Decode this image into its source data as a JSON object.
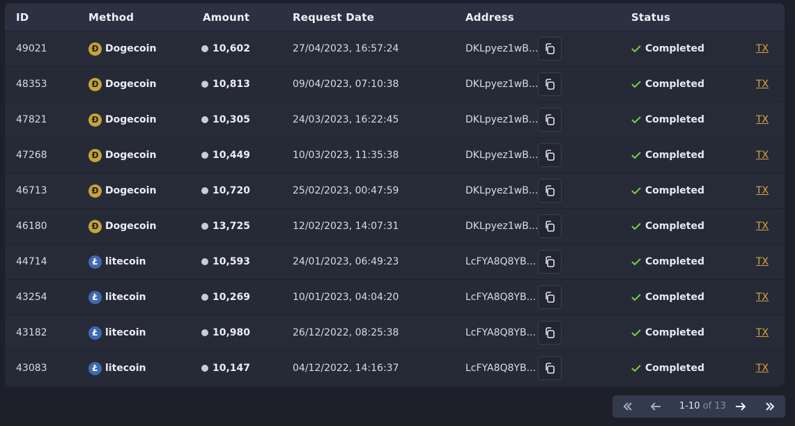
{
  "headers": {
    "id": "ID",
    "method": "Method",
    "amount": "Amount",
    "date": "Request Date",
    "address": "Address",
    "status": "Status"
  },
  "rows": [
    {
      "id": "49021",
      "method": "Dogecoin",
      "coin": "doge",
      "amount": "10,602",
      "date": "27/04/2023, 16:57:24",
      "address": "DKLpyez1wB...",
      "status": "Completed",
      "tx": "TX"
    },
    {
      "id": "48353",
      "method": "Dogecoin",
      "coin": "doge",
      "amount": "10,813",
      "date": "09/04/2023, 07:10:38",
      "address": "DKLpyez1wB...",
      "status": "Completed",
      "tx": "TX"
    },
    {
      "id": "47821",
      "method": "Dogecoin",
      "coin": "doge",
      "amount": "10,305",
      "date": "24/03/2023, 16:22:45",
      "address": "DKLpyez1wB...",
      "status": "Completed",
      "tx": "TX"
    },
    {
      "id": "47268",
      "method": "Dogecoin",
      "coin": "doge",
      "amount": "10,449",
      "date": "10/03/2023, 11:35:38",
      "address": "DKLpyez1wB...",
      "status": "Completed",
      "tx": "TX"
    },
    {
      "id": "46713",
      "method": "Dogecoin",
      "coin": "doge",
      "amount": "10,720",
      "date": "25/02/2023, 00:47:59",
      "address": "DKLpyez1wB...",
      "status": "Completed",
      "tx": "TX"
    },
    {
      "id": "46180",
      "method": "Dogecoin",
      "coin": "doge",
      "amount": "13,725",
      "date": "12/02/2023, 14:07:31",
      "address": "DKLpyez1wB...",
      "status": "Completed",
      "tx": "TX"
    },
    {
      "id": "44714",
      "method": "litecoin",
      "coin": "ltc",
      "amount": "10,593",
      "date": "24/01/2023, 06:49:23",
      "address": "LcFYA8Q8YB...",
      "status": "Completed",
      "tx": "TX"
    },
    {
      "id": "43254",
      "method": "litecoin",
      "coin": "ltc",
      "amount": "10,269",
      "date": "10/01/2023, 04:04:20",
      "address": "LcFYA8Q8YB...",
      "status": "Completed",
      "tx": "TX"
    },
    {
      "id": "43182",
      "method": "litecoin",
      "coin": "ltc",
      "amount": "10,980",
      "date": "26/12/2022, 08:25:38",
      "address": "LcFYA8Q8YB...",
      "status": "Completed",
      "tx": "TX"
    },
    {
      "id": "43083",
      "method": "litecoin",
      "coin": "ltc",
      "amount": "10,147",
      "date": "04/12/2022, 14:16:37",
      "address": "LcFYA8Q8YB...",
      "status": "Completed",
      "tx": "TX"
    }
  ],
  "pagination": {
    "range": "1-10",
    "total": "of 13"
  },
  "colors": {
    "accent_link": "#d7a53a",
    "status_ok": "#7ccf3f",
    "dogecoin": "#c6a43b",
    "litecoin": "#3f6ab1"
  },
  "icons": {
    "dogecoin": "dogecoin-icon",
    "litecoin": "litecoin-icon",
    "amount": "coin-dot-icon",
    "copy": "copy-icon",
    "status": "check-icon",
    "first": "double-chevron-left-icon",
    "prev": "arrow-left-icon",
    "next": "arrow-right-icon",
    "last": "double-chevron-right-icon"
  }
}
